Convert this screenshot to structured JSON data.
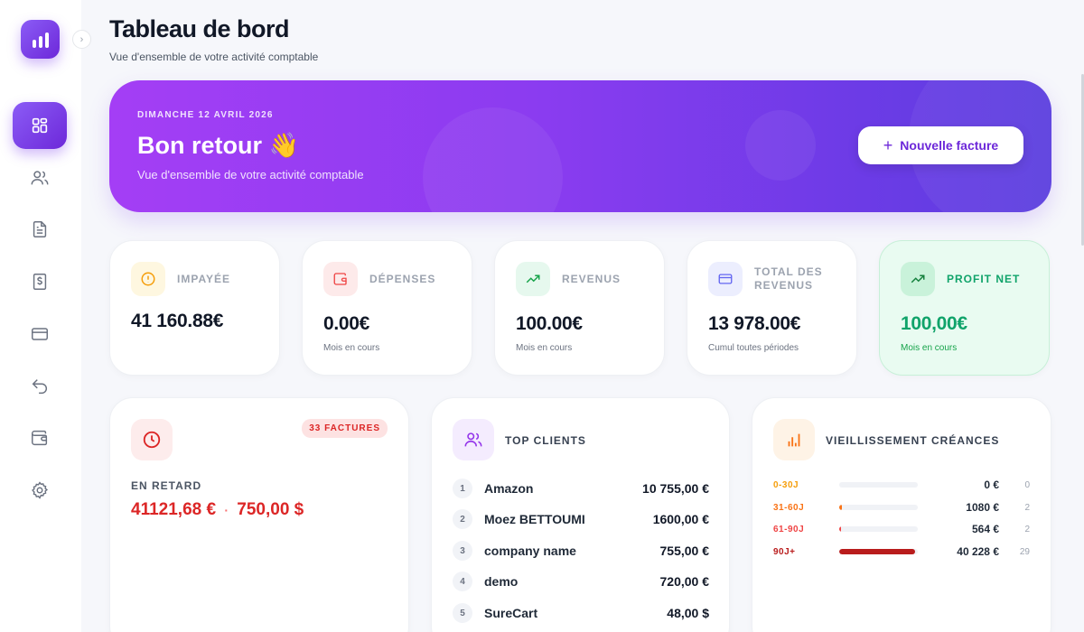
{
  "header": {
    "title": "Tableau de bord",
    "subtitle": "Vue d'ensemble de votre activité comptable"
  },
  "sidebar": {
    "items": [
      {
        "icon": "dashboard-icon",
        "active": true
      },
      {
        "icon": "users-icon",
        "active": false
      },
      {
        "icon": "document-icon",
        "active": false
      },
      {
        "icon": "dollar-receipt-icon",
        "active": false
      },
      {
        "icon": "credit-card-icon",
        "active": false
      },
      {
        "icon": "undo-arrow-icon",
        "active": false
      },
      {
        "icon": "wallet-icon",
        "active": false
      },
      {
        "icon": "settings-icon",
        "active": false
      }
    ]
  },
  "hero": {
    "date": "DIMANCHE 12 AVRIL 2026",
    "greeting": "Bon retour 👋",
    "subtitle": "Vue d'ensemble de votre activité comptable",
    "button_label": "Nouvelle facture"
  },
  "kpis": [
    {
      "label": "IMPAYÉE",
      "value": "41 160.88€",
      "sub": ""
    },
    {
      "label": "DÉPENSES",
      "value": "0.00€",
      "sub": "Mois en cours"
    },
    {
      "label": "REVENUS",
      "value": "100.00€",
      "sub": "Mois en cours"
    },
    {
      "label_line1": "TOTAL DES",
      "label_line2": "REVENUS",
      "value": "13 978.00€",
      "sub": "Cumul toutes périodes"
    },
    {
      "label": "PROFIT NET",
      "value": "100,00€",
      "sub": "Mois en cours"
    }
  ],
  "overdue": {
    "badge": "33 FACTURES",
    "label": "EN RETARD",
    "amount_eur": "41121,68 €",
    "separator": "·",
    "amount_usd": "750,00 $"
  },
  "top_clients": {
    "title": "TOP CLIENTS",
    "rows": [
      {
        "rank": "1",
        "name": "Amazon",
        "amount": "10 755,00 €"
      },
      {
        "rank": "2",
        "name": "Moez BETTOUMI",
        "amount": "1600,00 €"
      },
      {
        "rank": "3",
        "name": "company name",
        "amount": "755,00 €"
      },
      {
        "rank": "4",
        "name": "demo",
        "amount": "720,00 €"
      },
      {
        "rank": "5",
        "name": "SureCart",
        "amount": "48,00 $"
      }
    ]
  },
  "aging": {
    "title": "VIEILLISSEMENT CRÉANCES",
    "rows": [
      {
        "label": "0-30J",
        "amount": "0 €",
        "count": "0",
        "fill_fraction": 0.0,
        "color": "#f59e0b"
      },
      {
        "label": "31-60J",
        "amount": "1080 €",
        "count": "2",
        "fill_fraction": 0.03,
        "color": "#f97316"
      },
      {
        "label": "61-90J",
        "amount": "564 €",
        "count": "2",
        "fill_fraction": 0.015,
        "color": "#ef4444"
      },
      {
        "label": "90J+",
        "amount": "40 228 €",
        "count": "29",
        "fill_fraction": 0.96,
        "color": "#b91c1c"
      }
    ]
  },
  "colors": {
    "accent": "#7c3aed",
    "danger": "#dc2626",
    "success": "#10a36a"
  }
}
